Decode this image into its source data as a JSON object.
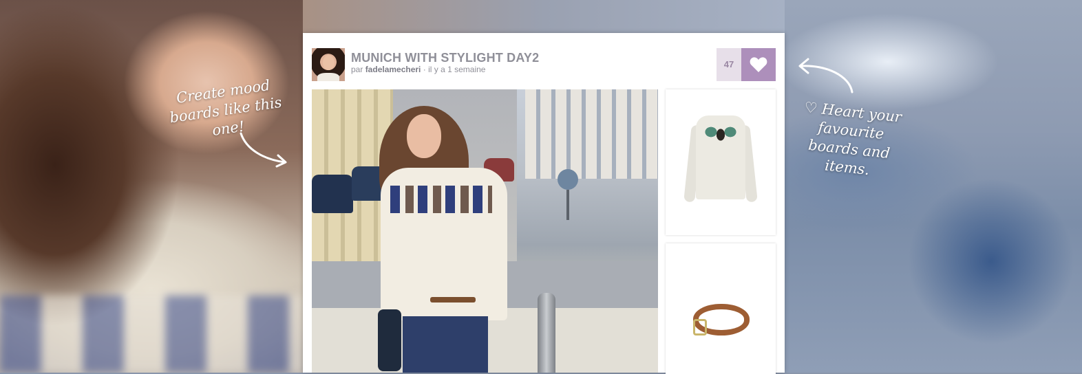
{
  "board": {
    "title": "MUNICH WITH STYLIGHT DAY2",
    "by_prefix": "par",
    "author": "fadelamecheri",
    "time": "· il y a 1 semaine",
    "heart_count": "47"
  },
  "callouts": {
    "left": "Create mood boards like this one!",
    "right": "♡ Heart your favourite boards and items."
  },
  "icons": {
    "heart": "heart-icon",
    "arrow_left": "curved-arrow-icon",
    "arrow_right": "curved-arrow-icon"
  },
  "colors": {
    "accent_heart": "#ad8fbb",
    "heart_count_bg": "#e7dfe9",
    "title_text": "#8f8f98"
  }
}
